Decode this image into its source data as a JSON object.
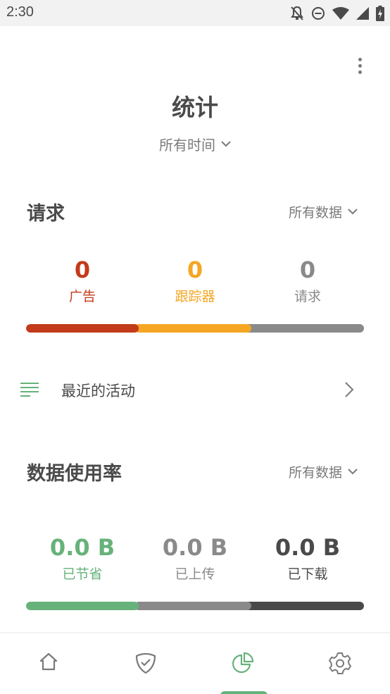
{
  "status_bar": {
    "time": "2:30",
    "icons": [
      "notifications-off-icon",
      "do-not-disturb-icon",
      "wifi-icon",
      "cellular-signal-icon",
      "battery-charging-icon"
    ]
  },
  "header": {
    "title": "统计",
    "period": "所有时间",
    "more_icon": "more-vert-icon"
  },
  "requests": {
    "title": "请求",
    "filter": "所有数据",
    "stats": [
      {
        "value": "0",
        "label": "广告",
        "color": "#c23b1a"
      },
      {
        "value": "0",
        "label": "跟踪器",
        "color": "#f5a623"
      },
      {
        "value": "0",
        "label": "请求",
        "color": "#8a8a8a"
      }
    ],
    "bar": [
      {
        "fraction": 0.333,
        "color": "#c23b1a"
      },
      {
        "fraction": 0.333,
        "color": "#f5a623"
      },
      {
        "fraction": 0.334,
        "color": "#8a8a8a"
      }
    ]
  },
  "recent_activity": {
    "label": "最近的活动",
    "icon": "list-lines-icon",
    "icon_color": "#66b27a"
  },
  "data_usage": {
    "title": "数据使用率",
    "filter": "所有数据",
    "stats": [
      {
        "value": "0.0 B",
        "label": "已节省",
        "color": "#66b27a"
      },
      {
        "value": "0.0 B",
        "label": "已上传",
        "color": "#8a8a8a"
      },
      {
        "value": "0.0 B",
        "label": "已下载",
        "color": "#4a4a4a"
      }
    ],
    "bar": [
      {
        "fraction": 0.333,
        "color": "#66b27a"
      },
      {
        "fraction": 0.333,
        "color": "#8a8a8a"
      },
      {
        "fraction": 0.334,
        "color": "#4a4a4a"
      }
    ]
  },
  "bottom_nav": {
    "items": [
      {
        "name": "home",
        "icon": "home-icon",
        "active": false
      },
      {
        "name": "protection",
        "icon": "shield-check-icon",
        "active": false
      },
      {
        "name": "statistics",
        "icon": "pie-chart-icon",
        "active": true
      },
      {
        "name": "settings",
        "icon": "gear-icon",
        "active": false
      }
    ],
    "active_color": "#66b27a",
    "inactive_color": "#7a7a7a"
  }
}
